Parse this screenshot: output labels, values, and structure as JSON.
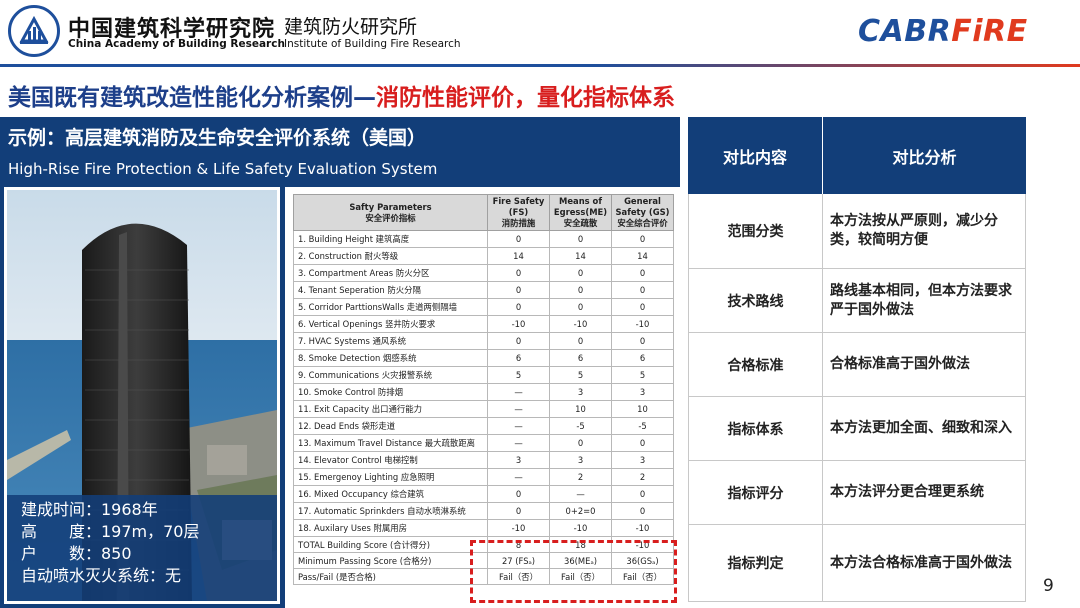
{
  "header": {
    "org_name_cn": "中国建筑科学研究院",
    "org_name_en": "China Academy of Building Research",
    "dept_name_cn": "建筑防火研究所",
    "dept_name_en": "Institute of Building Fire Research",
    "brand_part1": "CABR",
    "brand_part2": "FiRE",
    "logo_icon": "cabr-logo-icon",
    "colors": {
      "primary": "#1e4f9c",
      "accent": "#e03a1e",
      "panel": "#123e79",
      "title_red": "#d81e1e"
    }
  },
  "title": {
    "part1": "美国既有建筑改造性能化分析案例—",
    "part2": "消防性能评价，量化指标体系"
  },
  "system": {
    "title_cn": "示例：高层建筑消防及生命安全评价系统（美国）",
    "title_en": "High-Rise Fire Protection & Life Safety Evaluation System"
  },
  "building_info": [
    "建成时间：1968年",
    "高　　度：197m，70层",
    "户　　数：850",
    "自动喷水灭火系统：无"
  ],
  "eval_table": {
    "headers": [
      {
        "en": "Safty Parameters",
        "cn": "安全评价指标"
      },
      {
        "en": "Fire Safety (FS)",
        "cn": "消防措施"
      },
      {
        "en": "Means of Egress(ME)",
        "cn": "安全疏散"
      },
      {
        "en": "General Safety (GS)",
        "cn": "安全综合评价"
      }
    ],
    "rows": [
      [
        "1.  Building Height  建筑高度",
        "0",
        "0",
        "0"
      ],
      [
        "2.  Construction  耐火等级",
        "14",
        "14",
        "14"
      ],
      [
        "3.  Compartment Areas  防火分区",
        "0",
        "0",
        "0"
      ],
      [
        "4.  Tenant Seperation  防火分隔",
        "0",
        "0",
        "0"
      ],
      [
        "5.  Corridor ParttionsWalls 走道两侧隔墙",
        "0",
        "0",
        "0"
      ],
      [
        "6.  Vertical Openings  竖井防火要求",
        "-10",
        "-10",
        "-10"
      ],
      [
        "7.  HVAC Systems 通风系统",
        "0",
        "0",
        "0"
      ],
      [
        "8.  Smoke Detection 烟感系统",
        "6",
        "6",
        "6"
      ],
      [
        "9.  Communications 火灾报警系统",
        "5",
        "5",
        "5"
      ],
      [
        "10. Smoke Control 防排烟",
        "—",
        "3",
        "3"
      ],
      [
        "11. Exit Capacity  出口通行能力",
        "—",
        "10",
        "10"
      ],
      [
        "12. Dead Ends 袋形走道",
        "—",
        "-5",
        "-5"
      ],
      [
        "13. Maximum Travel Distance  最大疏散距离",
        "—",
        "0",
        "0"
      ],
      [
        "14. Elevator Control  电梯控制",
        "3",
        "3",
        "3"
      ],
      [
        "15. Emergenoy Lighting  应急照明",
        "—",
        "2",
        "2"
      ],
      [
        "16. Mixed Occupancy  综合建筑",
        "0",
        "—",
        "0"
      ],
      [
        "17. Automatic Sprinkders  自动水喷淋系统",
        "0",
        "0+2=0",
        "0"
      ],
      [
        "18. Auxilary Uses 附属用房",
        "-10",
        "-10",
        "-10"
      ]
    ],
    "summary": [
      [
        "TOTAL Building Score  (合计得分)",
        "8",
        "18",
        "-10"
      ],
      [
        "Minimum Passing Score  (合格分)",
        "27 (FSₐ)",
        "36(MEₐ)",
        "36(GSₐ)"
      ],
      [
        "Pass/Fail  (是否合格)",
        "Fail（否）",
        "Fail（否）",
        "Fail（否）"
      ]
    ]
  },
  "comparison": {
    "header": [
      "对比内容",
      "对比分析"
    ],
    "rows": [
      [
        "范围分类",
        "本方法按从严原则，减少分类，较简明方便"
      ],
      [
        "技术路线",
        "路线基本相同，但本方法要求严于国外做法"
      ],
      [
        "合格标准",
        "合格标准高于国外做法"
      ],
      [
        "指标体系",
        "本方法更加全面、细致和深入"
      ],
      [
        "指标评分",
        "本方法评分更合理更系统"
      ],
      [
        "指标判定",
        "本方法合格标准高于国外做法"
      ]
    ]
  },
  "page_number": "9"
}
